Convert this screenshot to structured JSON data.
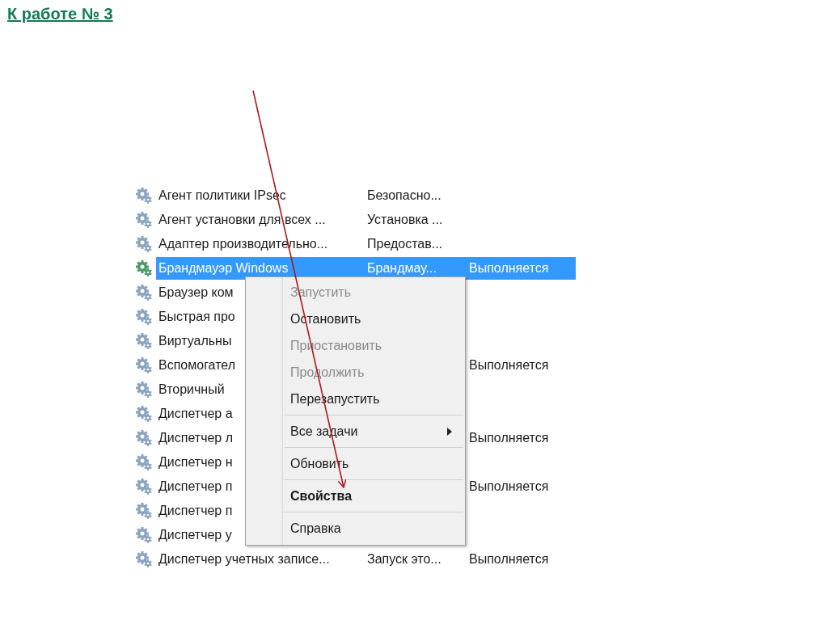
{
  "slide_title": "К работе № 3",
  "services": [
    {
      "name": "Агент политики IPsec",
      "description": "Безопасно...",
      "selected": false
    },
    {
      "name": "Агент установки для всех ...",
      "description": "Установка ...",
      "selected": false
    },
    {
      "name": "Адаптер производительно...",
      "description": "Предостав...",
      "selected": false
    },
    {
      "name": "Брандмауэр Windows",
      "description": "Брандмау...",
      "status": "Выполняется",
      "selected": true
    },
    {
      "name": "Браузер ком",
      "selected": false
    },
    {
      "name": "Быстрая про",
      "selected": false
    },
    {
      "name": "Виртуальны",
      "selected": false
    },
    {
      "name": "Вспомогател",
      "status": "Выполняется",
      "selected": false
    },
    {
      "name": "Вторичный",
      "selected": false
    },
    {
      "name": "Диспетчер а",
      "selected": false
    },
    {
      "name": "Диспетчер л",
      "status": "Выполняется",
      "selected": false
    },
    {
      "name": "Диспетчер н",
      "selected": false
    },
    {
      "name": "Диспетчер п",
      "status": "Выполняется",
      "selected": false
    },
    {
      "name": "Диспетчер п",
      "selected": false
    },
    {
      "name": "Диспетчер у",
      "selected": false
    },
    {
      "name": "Диспетчер учетных записе...",
      "description": "Запуск это...",
      "status": "Выполняется",
      "selected": false
    }
  ],
  "context_menu": [
    {
      "kind": "item",
      "label": "Запустить",
      "disabled": true,
      "default": false
    },
    {
      "kind": "item",
      "label": "Остановить",
      "disabled": false,
      "default": false
    },
    {
      "kind": "item",
      "label": "Приостановить",
      "disabled": true,
      "default": false
    },
    {
      "kind": "item",
      "label": "Продолжить",
      "disabled": true,
      "default": false
    },
    {
      "kind": "item",
      "label": "Перезапустить",
      "disabled": false,
      "default": false
    },
    {
      "kind": "separator"
    },
    {
      "kind": "submenu",
      "label": "Все задачи",
      "disabled": false,
      "default": false
    },
    {
      "kind": "separator"
    },
    {
      "kind": "item",
      "label": "Обновить",
      "disabled": false,
      "default": false
    },
    {
      "kind": "separator"
    },
    {
      "kind": "item",
      "label": "Свойства",
      "disabled": false,
      "default": true
    },
    {
      "kind": "separator"
    },
    {
      "kind": "item",
      "label": "Справка",
      "disabled": false,
      "default": false
    }
  ]
}
